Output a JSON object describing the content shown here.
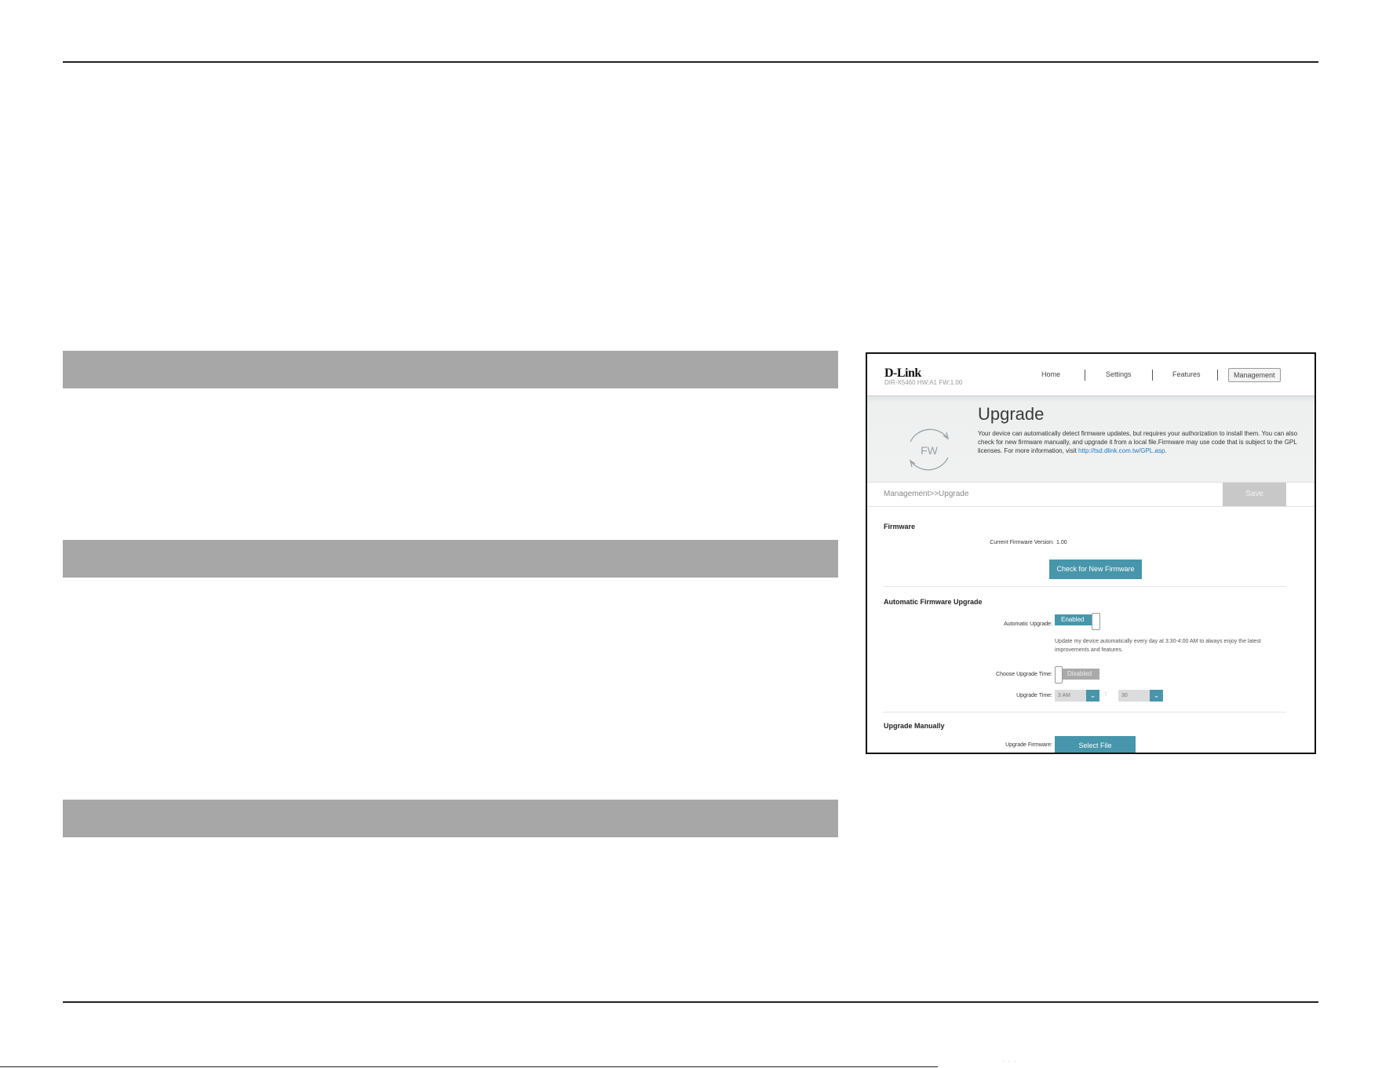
{
  "router": {
    "brand": "D-Link",
    "model_line": "DIR-X5460 HW:A1 FW:1.00",
    "nav": [
      "Home",
      "Settings",
      "Features",
      "Management"
    ],
    "page_title": "Upgrade",
    "icon_text": "FW",
    "description": "Your device can automatically detect firmware updates, but requires your authorization to install them. You can also check for new firmware manually, and upgrade it from a local file.Firmware may use code that is subject to the GPL licenses. For more information, visit ",
    "gpl_link": "http://tsd.dlink.com.tw/GPL.asp",
    "gpl_link_suffix": ".",
    "breadcrumb": "Management>>Upgrade",
    "save_label": "Save",
    "firmware": {
      "title": "Firmware",
      "current_version_label": "Current Firmware Version:",
      "current_version_value": "1.00",
      "check_button": "Check for New Firmware"
    },
    "auto": {
      "title": "Automatic Firmware Upgrade",
      "auto_label": "Automatic Upgrade:",
      "auto_state": "Enabled",
      "auto_note": "Update my device automatically every day at 3:30-4:00 AM to always enjoy the latest improvements and features.",
      "choose_label": "Choose Upgrade Time:",
      "choose_state": "Disabled",
      "time_label": "Upgrade Time:",
      "hour_value": "3 AM",
      "time_sep": ":",
      "minute_value": "30"
    },
    "manual": {
      "title": "Upgrade Manually",
      "firmware_label": "Upgrade Firmware:",
      "select_button": "Select File"
    }
  }
}
